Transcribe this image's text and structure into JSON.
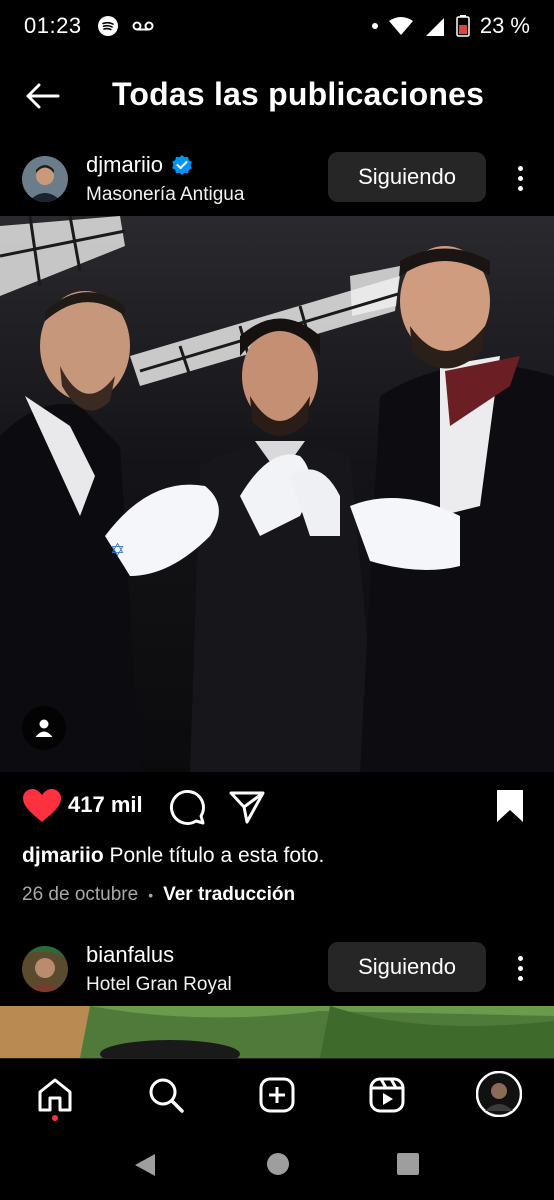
{
  "status_bar": {
    "time": "01:23",
    "battery": "23 %",
    "icons": [
      "spotify-icon",
      "voicemail-icon",
      "dot-icon",
      "wifi-icon",
      "signal-icon",
      "battery-icon"
    ]
  },
  "header": {
    "title": "Todas las publicaciones",
    "back_icon": "arrow-left-icon"
  },
  "post1": {
    "username": "djmariio",
    "verified": true,
    "location": "Masonería Antigua",
    "follow_label": "Siguiendo",
    "likes": "417 mil",
    "caption_user": "djmariio",
    "caption_text": "Ponle título a esta foto.",
    "date": "26 de octubre",
    "separator": "•",
    "translate_label": "Ver traducción"
  },
  "post2": {
    "username": "bianfalus",
    "location": "Hotel Gran Royal",
    "follow_label": "Siguiendo"
  },
  "bottom_nav": {
    "items": [
      "home-icon",
      "search-icon",
      "create-icon",
      "reels-icon",
      "profile-icon"
    ]
  },
  "colors": {
    "background": "#000000",
    "button_bg": "#262626",
    "like_red": "#ff3040",
    "verified_blue": "#0095f6",
    "muted_text": "#a8a8a8"
  }
}
